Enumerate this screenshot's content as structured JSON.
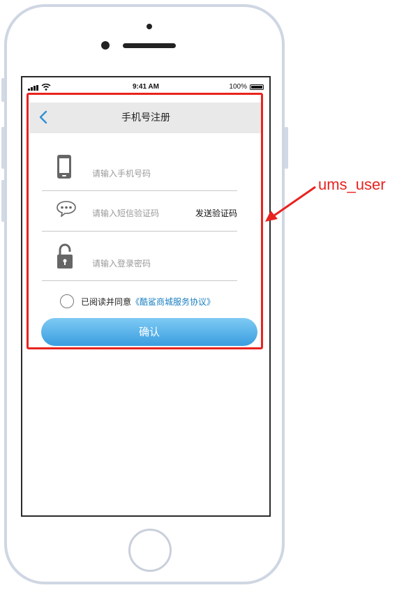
{
  "status_bar": {
    "time": "9:41 AM",
    "battery": "100%"
  },
  "navbar": {
    "title": "手机号注册"
  },
  "form": {
    "phone_placeholder": "请输入手机号码",
    "sms_placeholder": "请输入短信验证码",
    "send_code_label": "发送验证码",
    "password_placeholder": "请输入登录密码",
    "agree_prefix": "已阅读并同意",
    "agree_link": "《酷鲨商城服务协议》",
    "confirm_label": "确认"
  },
  "annotation": {
    "label": "ums_user",
    "color": "#e8231f"
  },
  "colors": {
    "accent": "#2f8fd6",
    "button": "#3a9ddf",
    "highlight_border": "#e8231f"
  },
  "icons": [
    "back-arrow-icon",
    "mobile-phone-icon",
    "chat-bubble-icon",
    "unlock-icon",
    "checkbox-circle-icon"
  ]
}
